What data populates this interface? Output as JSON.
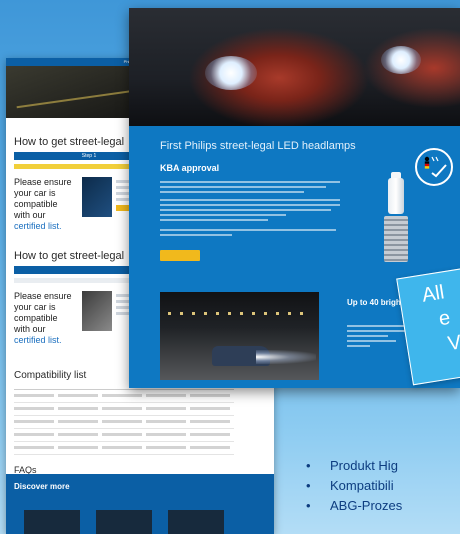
{
  "left_page": {
    "topbar_text": "Philips Automotive",
    "section1_title": "How to get street-legal",
    "section2_title": "How to get street-legal",
    "step_label": "Step 1",
    "card_text_1": "Please ensure your car is compatible with our ",
    "card_link_1": "certified list.",
    "card_text_2": "Please ensure your car is compatible with our ",
    "card_link_2": "certified list.",
    "compat_title": "Compatibility list",
    "faq_title": "FAQs",
    "discover_title": "Discover more"
  },
  "front_page": {
    "section_title": "First Philips street-legal LED headlamps",
    "subheading": "KBA approval",
    "right_heading": "Up to 40 brighter",
    "badge_label": "DE"
  },
  "callout": {
    "line1": "All",
    "line2": "e",
    "line3": "V"
  },
  "bullets": [
    "Produkt Hig",
    "Kompatibili",
    "ABG-Prozes"
  ],
  "colors": {
    "background": "#4ea4e0",
    "brand_blue": "#0e78c2",
    "accent_yellow": "#f1b91c",
    "bullet_text": "#0d3d80"
  }
}
